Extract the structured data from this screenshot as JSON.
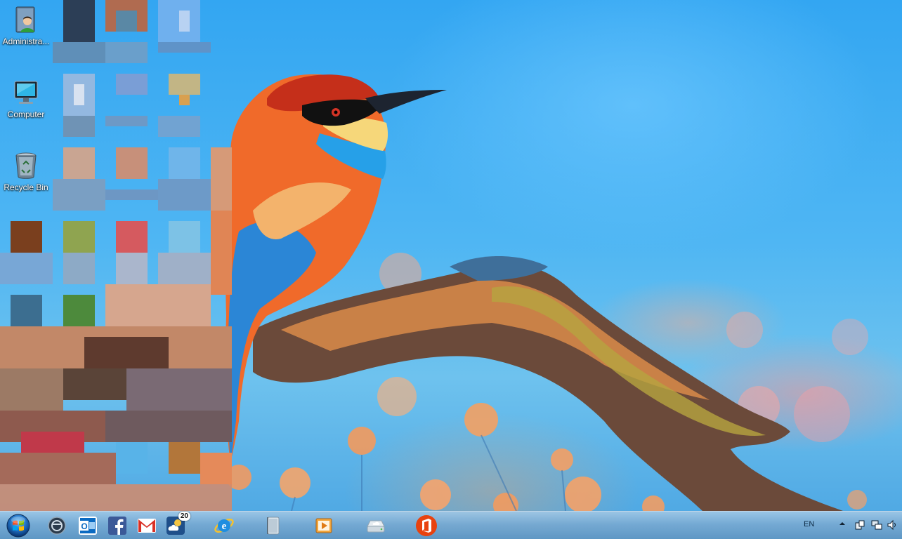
{
  "desktop": {
    "icons": [
      {
        "name": "administrator-folder",
        "label": "Administra...",
        "icon": "user-folder-icon"
      },
      {
        "name": "computer",
        "label": "Computer",
        "icon": "monitor-icon"
      },
      {
        "name": "recycle-bin",
        "label": "Recycle Bin",
        "icon": "recycle-bin-icon"
      }
    ]
  },
  "taskbar": {
    "start": {
      "icon": "windows-orb-icon"
    },
    "pinned": [
      {
        "name": "app-circle",
        "icon": "circle-app-icon"
      },
      {
        "name": "outlook",
        "icon": "outlook-icon"
      },
      {
        "name": "facebook",
        "icon": "facebook-icon"
      },
      {
        "name": "gmail",
        "icon": "gmail-icon"
      },
      {
        "name": "weather",
        "icon": "weather-icon",
        "badge": "20"
      },
      {
        "name": "internet-explorer",
        "icon": "ie-icon"
      },
      {
        "name": "notebook",
        "icon": "notebook-icon"
      },
      {
        "name": "media-player",
        "icon": "media-player-icon"
      },
      {
        "name": "cloud-drive",
        "icon": "cloud-drive-icon"
      },
      {
        "name": "office",
        "icon": "office-icon"
      }
    ],
    "tray": {
      "language": "EN",
      "icons": [
        "show-hidden-icons-arrow",
        "network-device-icon",
        "network-icon",
        "volume-icon"
      ]
    }
  }
}
